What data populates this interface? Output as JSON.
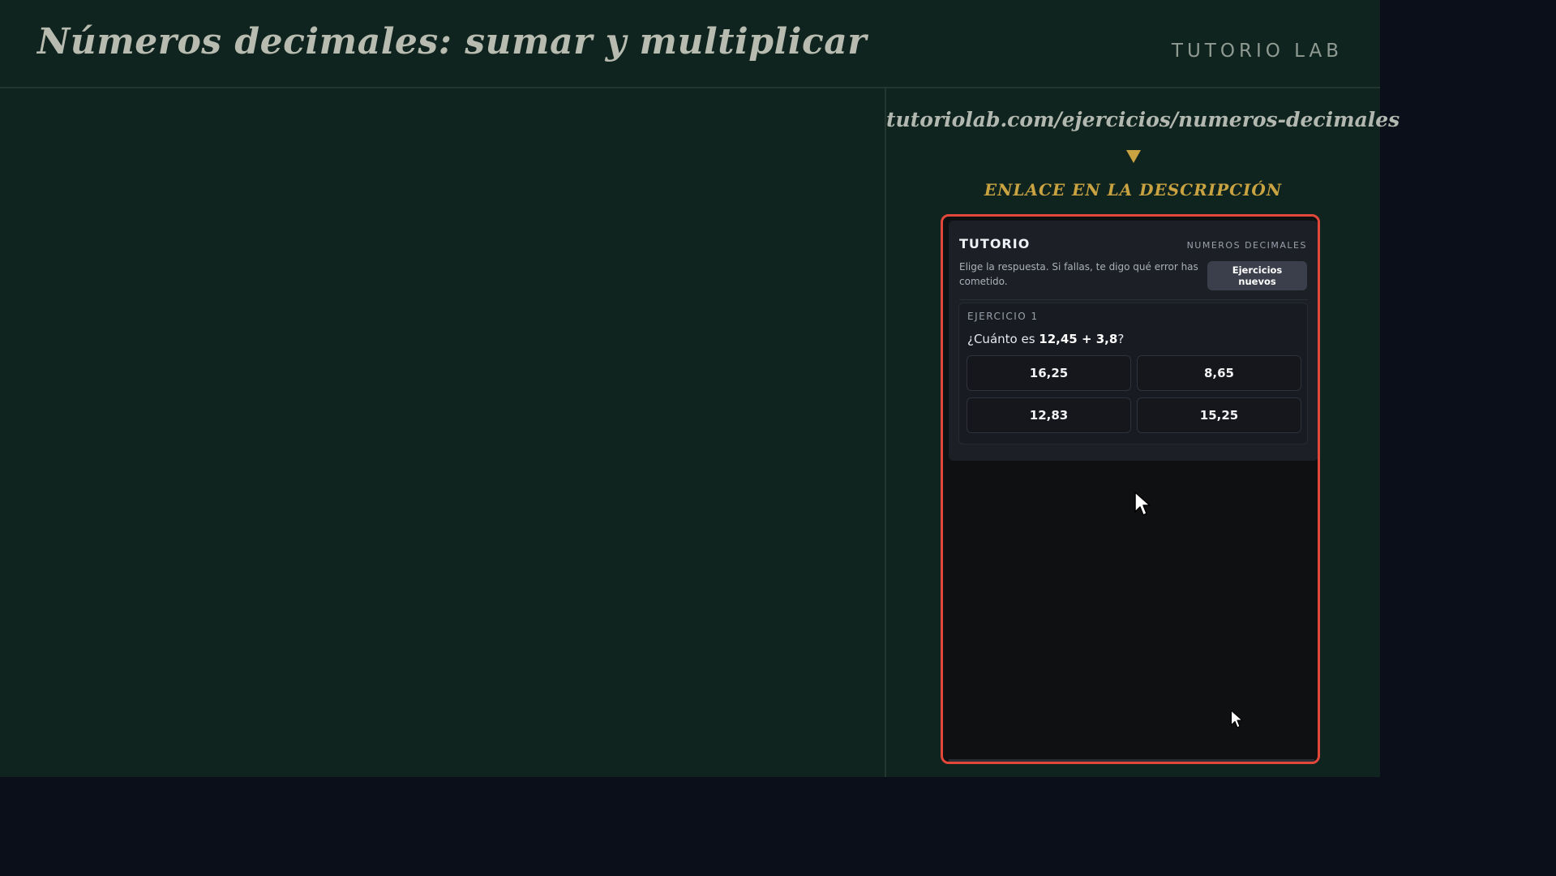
{
  "header": {
    "title": "Números decimales: sumar y multiplicar",
    "brand": "TUTORIO LAB"
  },
  "side": {
    "url": "tutoriolab.com/ejercicios/numeros-decimales",
    "cta": "ENLACE EN LA DESCRIPCIÓN",
    "arrow_color": "#c9a341",
    "highlight_color": "#e2483a"
  },
  "widget": {
    "brand": "TUTORIO",
    "topic": "NUMEROS DECIMALES",
    "description": "Elige la respuesta. Si fallas, te digo qué error has cometido.",
    "new_button": "Ejercicios nuevos",
    "exercise": {
      "label": "EJERCICIO 1",
      "question_prefix": "¿Cuánto es ",
      "question_expr": "12,45 + 3,8",
      "question_suffix": "?",
      "options": [
        "16,25",
        "8,65",
        "12,83",
        "15,25"
      ]
    }
  },
  "icons": [
    "mouse-cursor-icon"
  ]
}
